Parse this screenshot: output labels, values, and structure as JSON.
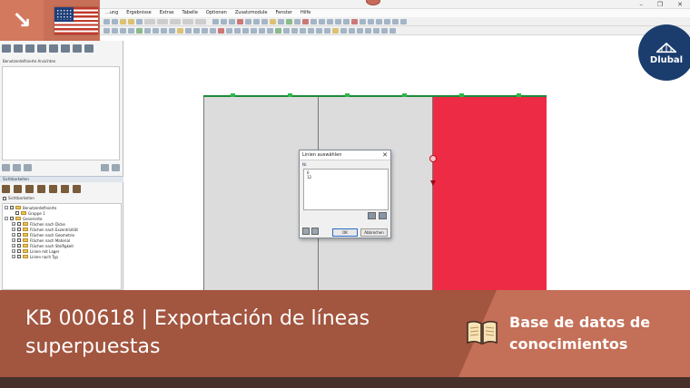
{
  "app": {
    "menu": [
      "...ung",
      "Ergebnisse",
      "Extras",
      "Tabelle",
      "Optionen",
      "Zusatzmodule",
      "Fenster",
      "Hilfe"
    ]
  },
  "left_panel": {
    "views_label": "Benutzerdefinierte Ansichten",
    "visibility_header": "Sichtbarkeiten",
    "visibility_checkbox": "Sichtbarkeiten",
    "tree": [
      {
        "label": "Benutzerdefinierte",
        "level": 0
      },
      {
        "label": "Gruppe 1",
        "level": 1
      },
      {
        "label": "Generierte",
        "level": 0
      },
      {
        "label": "Flächen nach Dicke",
        "level": 1
      },
      {
        "label": "Flächen nach Exzentrizität",
        "level": 1
      },
      {
        "label": "Flächen nach Geometrie",
        "level": 1
      },
      {
        "label": "Flächen nach Material",
        "level": 1
      },
      {
        "label": "Flächen nach Steifigkeit",
        "level": 1
      },
      {
        "label": "Linien mit Lager",
        "level": 1
      },
      {
        "label": "Linien nach Typ",
        "level": 1
      }
    ]
  },
  "dialog": {
    "title": "Linien auswählen",
    "group_label": "Nr.",
    "items": [
      "6",
      "12"
    ],
    "ok_label": "OK",
    "cancel_label": "Abbrechen"
  },
  "brand": {
    "name": "Dlubal",
    "badge_color": "#1b3d6e"
  },
  "banner": {
    "title": "KB 000618 | Exportación de líneas superpuestas",
    "subtitle": "Base de datos de conocimientos",
    "color_main": "#a2553f",
    "color_accent": "#c46f57"
  },
  "colors": {
    "highlight_surface": "#ee2b45",
    "surface": "#dcdcdc",
    "node": "#2db84a"
  }
}
